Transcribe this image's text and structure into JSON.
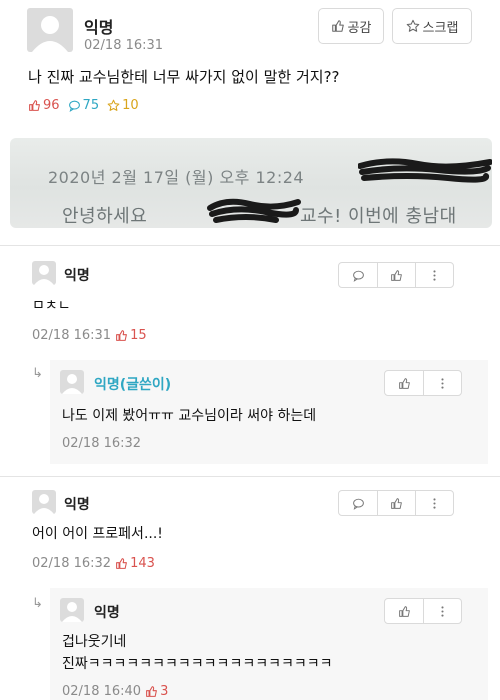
{
  "post": {
    "author": "익명",
    "time": "02/18 16:31",
    "like_button": "공감",
    "scrap_button": "스크랩",
    "body": "나 진짜 교수님한테 너무 싸가지 없이 말한 거지??",
    "stats": {
      "likes": "96",
      "comments": "75",
      "scraps": "10"
    },
    "photo": {
      "line1": "2020년 2월 17일 (월) 오후 12:24",
      "line2": "안녕하세요",
      "line2_tail": "교수! 이번에 충남대"
    }
  },
  "comments": [
    {
      "author": "익명",
      "body": "ㅁㅊㄴ",
      "time": "02/18 16:31",
      "likes": "15",
      "reply": {
        "author": "익명(글쓴이)",
        "body": "나도 이제 봤어ㅠㅠ 교수님이라 써야 하는데",
        "time": "02/18 16:32"
      }
    },
    {
      "author": "익명",
      "body": "어이 어이 프로페서...!",
      "time": "02/18 16:32",
      "likes": "143",
      "reply": {
        "author": "익명",
        "body_line1": "겁나웃기네",
        "body_line2": "진짜ㅋㅋㅋㅋㅋㅋㅋㅋㅋㅋㅋㅋㅋㅋㅋㅋㅋㅋㅋ",
        "time": "02/18 16:40",
        "likes": "3"
      }
    }
  ],
  "icons": {
    "like": "thumbs-up-icon",
    "comment": "speech-bubble-icon",
    "scrap": "star-icon",
    "more": "vertical-dots-icon",
    "reply": "reply-arrow-icon"
  },
  "colors": {
    "like": "#d9534f",
    "comment": "#2fa7c3",
    "scrap": "#d9a51c",
    "op_author": "#2fa7c3"
  }
}
